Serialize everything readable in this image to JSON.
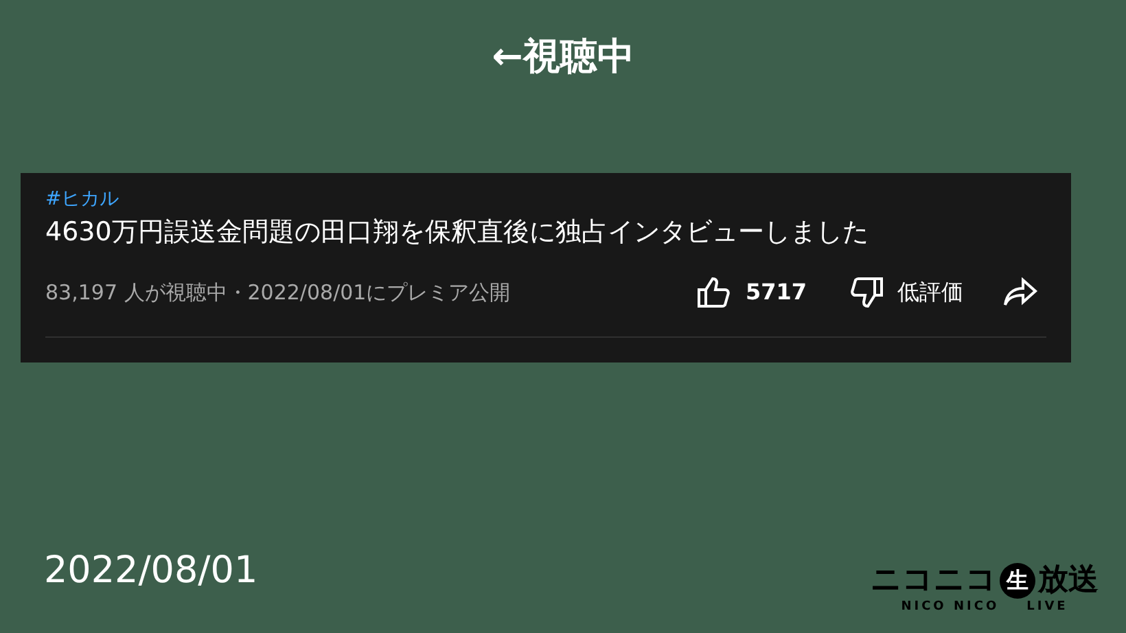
{
  "caption": "←視聴中",
  "video": {
    "hashtag": "#ヒカル",
    "title": "4630万円誤送金問題の田口翔を保釈直後に独占インタビューしました",
    "meta": "83,197 人が視聴中・2022/08/01にプレミア公開",
    "likes": "5717",
    "dislike_label": "低評価"
  },
  "date": "2022/08/01",
  "logo": {
    "main_left": "ニコニコ",
    "badge": "生",
    "main_right": "放送",
    "sub_left": "NICO NICO",
    "sub_right": "LIVE"
  }
}
